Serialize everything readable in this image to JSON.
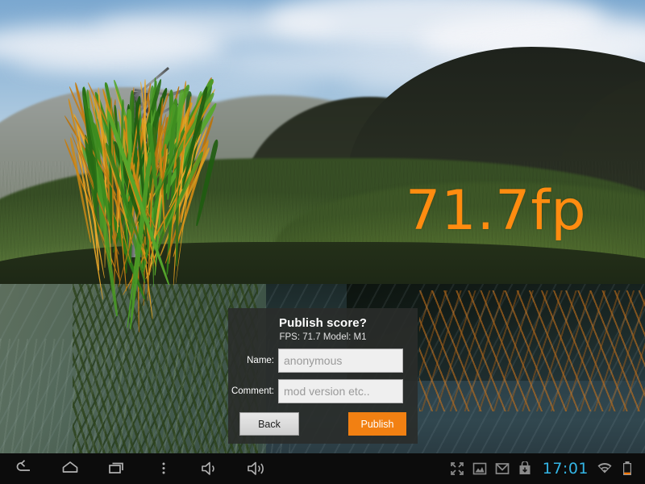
{
  "scene": {
    "fps_overlay": "71.7fp",
    "description": "3d-landscape-willow-tree-lake"
  },
  "dialog": {
    "title": "Publish score?",
    "subtitle": "FPS:  71.7 Model: M1",
    "fields": [
      {
        "label": "Name:",
        "value": "anonymous",
        "placeholder": "anonymous"
      },
      {
        "label": "Comment:",
        "value": "mod version etc..",
        "placeholder": "mod version etc.."
      }
    ],
    "back_label": "Back",
    "publish_label": "Publish",
    "accent_color": "#f28012",
    "background_color": "#2a2c2a"
  },
  "navbar": {
    "buttons": [
      {
        "name": "back-icon",
        "label": "Back"
      },
      {
        "name": "home-icon",
        "label": "Home"
      },
      {
        "name": "recents-icon",
        "label": "Recent apps"
      },
      {
        "name": "overflow-menu-icon",
        "label": "Menu"
      },
      {
        "name": "volume-down-icon",
        "label": "Volume down"
      },
      {
        "name": "volume-up-icon",
        "label": "Volume up"
      }
    ],
    "status_icons": [
      {
        "name": "fullscreen-icon",
        "label": "Fullscreen"
      },
      {
        "name": "screenshot-icon",
        "label": "Screenshot"
      },
      {
        "name": "gmail-icon",
        "label": "Gmail"
      },
      {
        "name": "download-icon",
        "label": "Download"
      }
    ],
    "clock": "17:01",
    "clock_color": "#33b5e5",
    "wifi": "wifi-icon",
    "battery": "battery-low-icon",
    "battery_indicator_color": "#ff7700"
  }
}
